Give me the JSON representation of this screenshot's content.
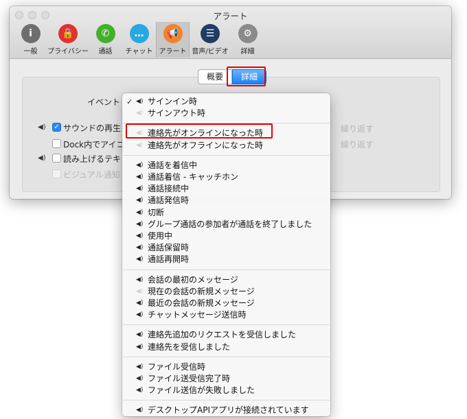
{
  "window": {
    "title": "アラート"
  },
  "toolbar": [
    {
      "name": "tab-general",
      "icon": "info-icon",
      "label": "一般",
      "color": "#6e6e6e",
      "glyph": "i",
      "wide": false,
      "active": false
    },
    {
      "name": "tab-privacy",
      "icon": "lock-icon",
      "label": "プライバシー",
      "color": "#e23131",
      "glyph": "🔒",
      "wide": true,
      "active": false
    },
    {
      "name": "tab-calls",
      "icon": "phone-icon",
      "label": "通話",
      "color": "#43b02a",
      "glyph": "✆",
      "wide": false,
      "active": false
    },
    {
      "name": "tab-chat",
      "icon": "chat-bubble-icon",
      "label": "チャット",
      "color": "#27a8e0",
      "glyph": "…",
      "wide": false,
      "active": false
    },
    {
      "name": "tab-alerts",
      "icon": "megaphone-icon",
      "label": "アラート",
      "color": "#f2832a",
      "glyph": "📢",
      "wide": false,
      "active": true
    },
    {
      "name": "tab-audio-video",
      "icon": "equalizer-icon",
      "label": "音声/ビデオ",
      "color": "#1f3c63",
      "glyph": "☰",
      "wide": true,
      "active": false
    },
    {
      "name": "tab-advanced",
      "icon": "gear-icon",
      "label": "詳細",
      "color": "#8a8a8a",
      "glyph": "⚙",
      "wide": false,
      "active": false
    }
  ],
  "segment": {
    "summary": "概要",
    "details": "詳細"
  },
  "settings": {
    "event_label": "イベント",
    "play_sound": "サウンドの再生",
    "dock_bounce": "Dock内でアイコ",
    "read_aloud": "読み上げるテキ",
    "visual_notification": "ビジュアル通知",
    "repeat1": "繰り返す",
    "repeat2": "繰り返す"
  },
  "menu": {
    "groups": [
      [
        {
          "label": "サインイン時",
          "checked": true,
          "sound": true
        },
        {
          "label": "サインアウト時",
          "checked": false,
          "sound": false
        }
      ],
      [
        {
          "label": "連絡先がオンラインになった時",
          "checked": false,
          "sound": false,
          "highlight": true
        },
        {
          "label": "連絡先がオフラインになった時",
          "checked": false,
          "sound": false
        }
      ],
      [
        {
          "label": "通話を着信中",
          "checked": false,
          "sound": true
        },
        {
          "label": "通話着信 - キャッチホン",
          "checked": false,
          "sound": true
        },
        {
          "label": "通話接続中",
          "checked": false,
          "sound": true
        },
        {
          "label": "通話発信時",
          "checked": false,
          "sound": true
        },
        {
          "label": "切断",
          "checked": false,
          "sound": true
        },
        {
          "label": "グループ通話の参加者が通話を終了しました",
          "checked": false,
          "sound": true
        },
        {
          "label": "使用中",
          "checked": false,
          "sound": true
        },
        {
          "label": "通話保留時",
          "checked": false,
          "sound": true
        },
        {
          "label": "通話再開時",
          "checked": false,
          "sound": true
        }
      ],
      [
        {
          "label": "会話の最初のメッセージ",
          "checked": false,
          "sound": true
        },
        {
          "label": "現在の会話の新規メッセージ",
          "checked": false,
          "sound": false
        },
        {
          "label": "最近の会話の新規メッセージ",
          "checked": false,
          "sound": true
        },
        {
          "label": "チャットメッセージ送信時",
          "checked": false,
          "sound": true
        }
      ],
      [
        {
          "label": "連絡先追加のリクエストを受信しました",
          "checked": false,
          "sound": true
        },
        {
          "label": "連絡先を受信しました",
          "checked": false,
          "sound": true
        }
      ],
      [
        {
          "label": "ファイル受信時",
          "checked": false,
          "sound": true
        },
        {
          "label": "ファイル送受信完了時",
          "checked": false,
          "sound": true
        },
        {
          "label": "ファイル送信が失敗しました",
          "checked": false,
          "sound": true
        }
      ],
      [
        {
          "label": "デスクトップAPIアプリが接続されています",
          "checked": false,
          "sound": true
        }
      ]
    ]
  }
}
